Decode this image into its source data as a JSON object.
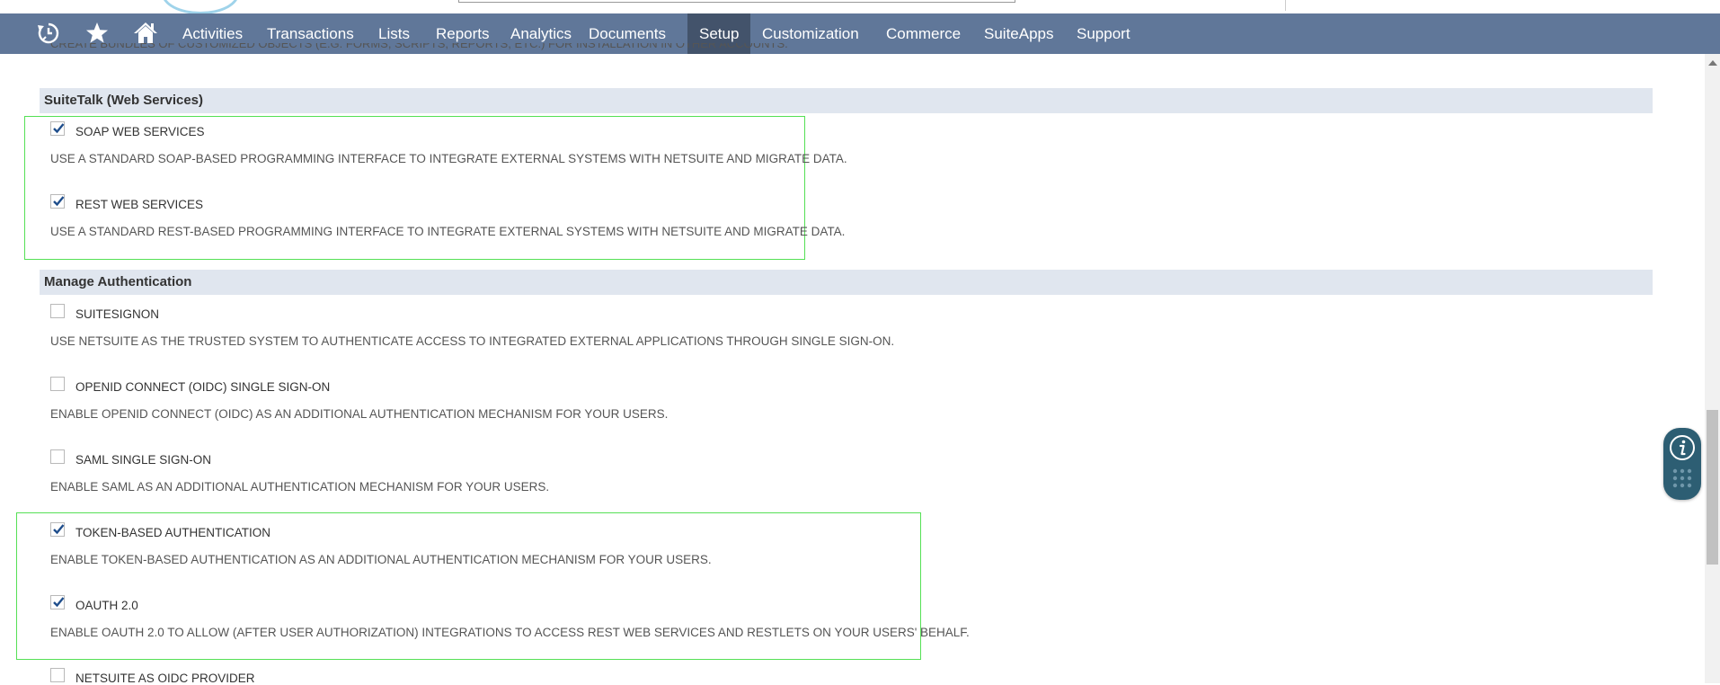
{
  "nav": {
    "icons": [
      {
        "name": "recent-records-icon"
      },
      {
        "name": "shortcuts-star-icon"
      },
      {
        "name": "home-icon"
      }
    ],
    "items": [
      "Activities",
      "Transactions",
      "Lists",
      "Reports",
      "Analytics",
      "Documents",
      "Setup",
      "Customization",
      "Commerce",
      "SuiteApps",
      "Support"
    ],
    "active_item": "Setup"
  },
  "clipped_top_text": "CREATE BUNDLES OF CUSTOMIZED OBJECTS (E.G. FORMS, SCRIPTS, REPORTS, ETC.) FOR INSTALLATION IN OTHER ACCOUNTS.",
  "sections": [
    {
      "title": "SuiteTalk (Web Services)",
      "features": [
        {
          "label": "SOAP WEB SERVICES",
          "checked": true,
          "description": "USE A STANDARD SOAP-BASED PROGRAMMING INTERFACE TO INTEGRATE EXTERNAL SYSTEMS WITH NETSUITE AND MIGRATE DATA."
        },
        {
          "label": "REST WEB SERVICES",
          "checked": true,
          "description": "USE A STANDARD REST-BASED PROGRAMMING INTERFACE TO INTEGRATE EXTERNAL SYSTEMS WITH NETSUITE AND MIGRATE DATA."
        }
      ]
    },
    {
      "title": "Manage Authentication",
      "features": [
        {
          "label": "SUITESIGNON",
          "checked": false,
          "description": "USE NETSUITE AS THE TRUSTED SYSTEM TO AUTHENTICATE ACCESS TO INTEGRATED EXTERNAL APPLICATIONS THROUGH SINGLE SIGN-ON."
        },
        {
          "label": "OPENID CONNECT (OIDC) SINGLE SIGN-ON",
          "checked": false,
          "description": "ENABLE OPENID CONNECT (OIDC) AS AN ADDITIONAL AUTHENTICATION MECHANISM FOR YOUR USERS."
        },
        {
          "label": "SAML SINGLE SIGN-ON",
          "checked": false,
          "description": "ENABLE SAML AS AN ADDITIONAL AUTHENTICATION MECHANISM FOR YOUR USERS."
        },
        {
          "label": "TOKEN-BASED AUTHENTICATION",
          "checked": true,
          "description": "ENABLE TOKEN-BASED AUTHENTICATION AS AN ADDITIONAL AUTHENTICATION MECHANISM FOR YOUR USERS."
        },
        {
          "label": "OAUTH 2.0",
          "checked": true,
          "description": "ENABLE OAUTH 2.0 TO ALLOW (AFTER USER AUTHORIZATION) INTEGRATIONS TO ACCESS REST WEB SERVICES AND RESTLETS ON YOUR USERS' BEHALF."
        },
        {
          "label": "NETSUITE AS OIDC PROVIDER",
          "checked": false,
          "description": ""
        }
      ]
    }
  ],
  "help_widget": {
    "info_icon": "info-icon",
    "grid_icon": "keypad-grid-icon"
  },
  "colors": {
    "nav_bg": "#607799",
    "nav_active_bg": "#43536b",
    "section_header_bg": "#e0e6ef",
    "highlight_border": "#55e055",
    "checkmark": "#1f4e8c",
    "help_widget_bg": "#2d5e73"
  }
}
